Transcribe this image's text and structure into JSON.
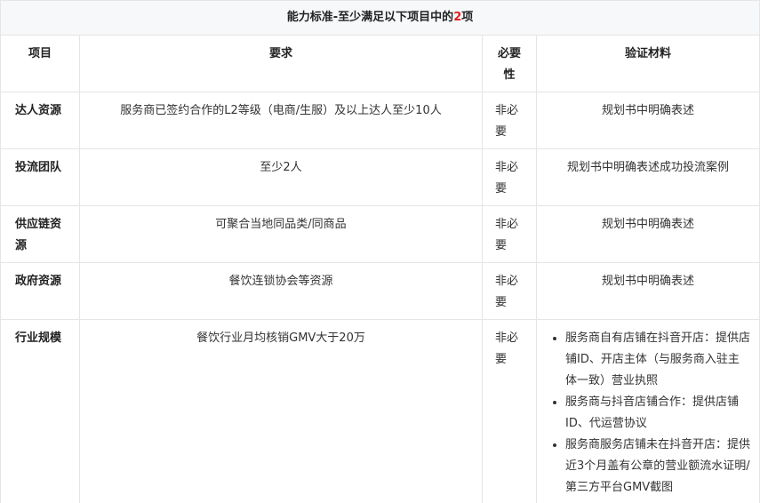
{
  "title": {
    "prefix": "能力标准-至少满足以下项目中的",
    "highlight": "2",
    "suffix": "项"
  },
  "headers": {
    "item": "项目",
    "requirement": "要求",
    "necessity": "必要性",
    "material": "验证材料"
  },
  "rows": [
    {
      "name": "达人资源",
      "requirement": "服务商已签约合作的L2等级（电商/生服）及以上达人至少10人",
      "necessity": "非必要",
      "material": "规划书中明确表述"
    },
    {
      "name": "投流团队",
      "requirement": "至少2人",
      "necessity": "非必要",
      "material": "规划书中明确表述成功投流案例"
    },
    {
      "name": "供应链资源",
      "requirement": "可聚合当地同品类/同商品",
      "necessity": "非必要",
      "material": "规划书中明确表述"
    },
    {
      "name": "政府资源",
      "requirement": "餐饮连锁协会等资源",
      "necessity": "非必要",
      "material": "规划书中明确表述"
    },
    {
      "name": "行业规模",
      "requirement": "餐饮行业月均核销GMV大于20万",
      "necessity": "非必要",
      "material_list": [
        "服务商自有店铺在抖音开店：提供店铺ID、开店主体（与服务商入驻主体一致）营业执照",
        "服务商与抖音店铺合作：提供店铺ID、代运营协议",
        "服务商服务店铺未在抖音开店：提供近3个月盖有公章的营业额流水证明/第三方平台GMV截图"
      ]
    }
  ]
}
